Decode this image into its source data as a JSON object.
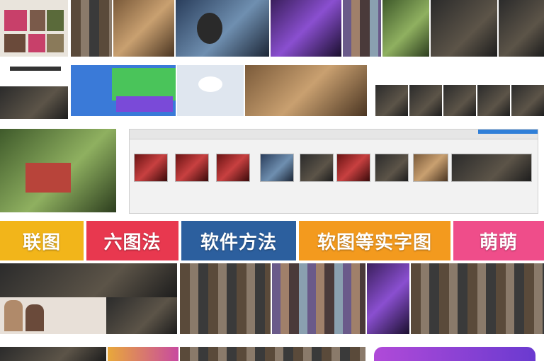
{
  "banners": [
    {
      "label": "联图",
      "color": "#f2b51a"
    },
    {
      "label": "六图法",
      "color": "#e8384f"
    },
    {
      "label": "软件方法",
      "color": "#2c5f9e"
    },
    {
      "label": "软图等实字图",
      "color": "#f39a1e"
    },
    {
      "label": "萌萌",
      "color": "#ef4d8a"
    }
  ],
  "colors": {
    "window_blue_tab": "#2f7fd8"
  }
}
